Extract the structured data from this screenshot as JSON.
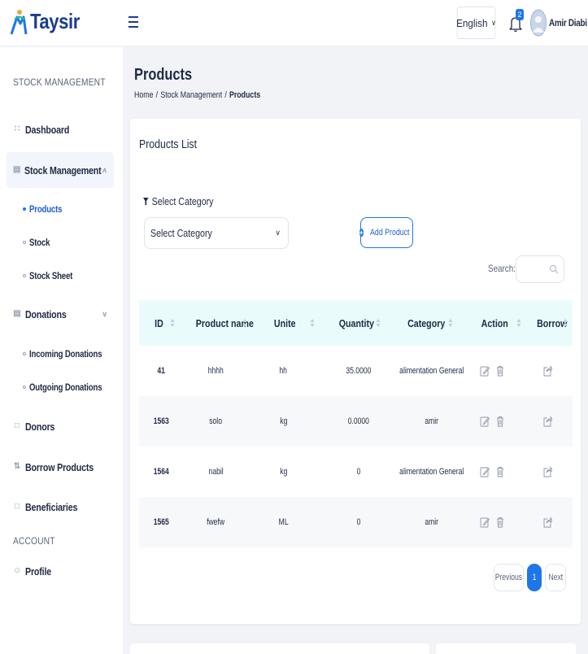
{
  "header": {
    "brand": "Taysir",
    "language": "English",
    "notification_count": "2",
    "user_name": "Amir Diabi"
  },
  "sidebar": {
    "section_main": "STOCK MANAGEMENT",
    "section_account": "ACCOUNT",
    "items": [
      {
        "label": "Dashboard",
        "icon": "grid-icon"
      },
      {
        "label": "Stock Management",
        "icon": "storage-icon"
      },
      {
        "label": "Donations",
        "icon": "document-icon"
      },
      {
        "label": "Donors",
        "icon": "donor-icon"
      },
      {
        "label": "Borrow Products",
        "icon": "swap-icon"
      },
      {
        "label": "Beneficiaries",
        "icon": "bag-icon"
      },
      {
        "label": "Profile",
        "icon": "user-icon"
      }
    ],
    "stock_sub": [
      "Products",
      "Stock",
      "Stock Sheet"
    ],
    "donation_sub": [
      "Incoming Donations",
      "Outgoing Donations"
    ]
  },
  "page": {
    "title": "Products",
    "breadcrumb": [
      "Home",
      "Stock Management",
      "Products"
    ]
  },
  "card": {
    "title": "Products List",
    "filter_label": "Select Category",
    "select_value": "Select Category",
    "add_button": "Add Product",
    "search_label": "Search:",
    "search_placeholder": ""
  },
  "table": {
    "columns": [
      "ID",
      "Product name",
      "Unite",
      "Quantity",
      "Category",
      "Action",
      "Borrow"
    ],
    "rows": [
      {
        "id": "41",
        "name": "hhhh",
        "unite": "hh",
        "quantity": "35.0000",
        "category": "alimentation General"
      },
      {
        "id": "1563",
        "name": "solo",
        "unite": "kg",
        "quantity": "0.0000",
        "category": "amir"
      },
      {
        "id": "1564",
        "name": "nabil",
        "unite": "kg",
        "quantity": "0",
        "category": "alimentation General"
      },
      {
        "id": "1565",
        "name": "fwefw",
        "unite": "ML",
        "quantity": "0",
        "category": "amir"
      }
    ]
  },
  "pagination": {
    "previous": "Previous",
    "current": "1",
    "next": "Next"
  },
  "colors": {
    "accent": "#1e76e8",
    "brand": "#1b3c8d",
    "table_header_bg": "#eafbfc"
  }
}
